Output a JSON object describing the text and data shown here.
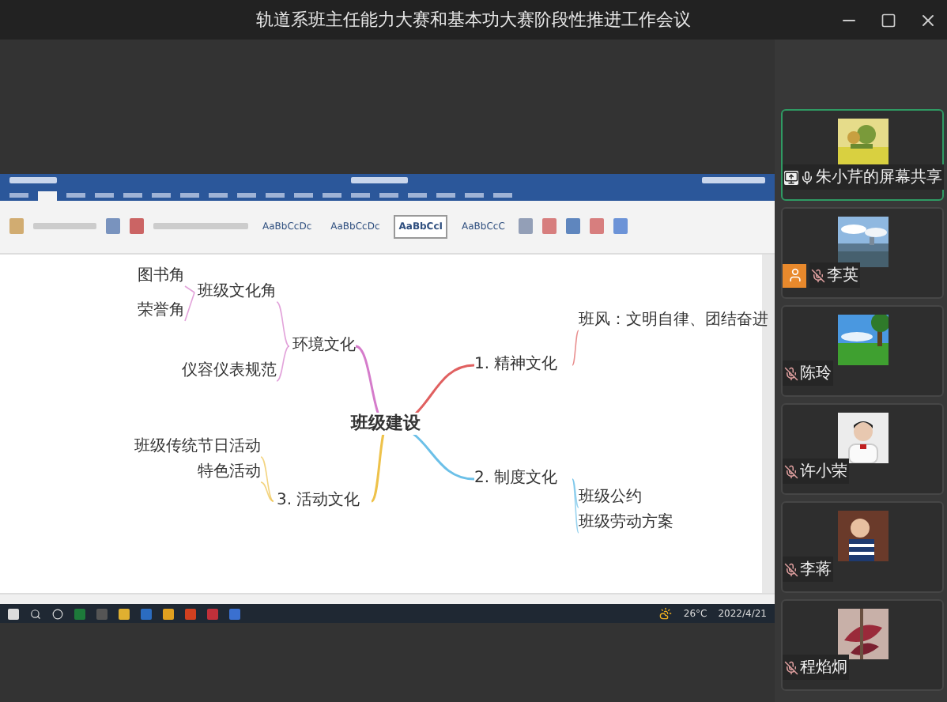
{
  "window": {
    "title": "轨道系班主任能力大赛和基本功大赛阶段性推进工作会议"
  },
  "shared_screen": {
    "style_samples": [
      {
        "label": "AaBbCcDc",
        "selected": false
      },
      {
        "label": "AaBbCcDc",
        "selected": false
      },
      {
        "label": "AaBbCcI",
        "selected": true
      },
      {
        "label": "AaBbCcC",
        "selected": false
      }
    ],
    "mind_map": {
      "center": "班级建设",
      "branches": [
        {
          "label": "环境文化",
          "color": "#d57ccb",
          "children": [
            {
              "label": "班级文化角",
              "children": [
                {
                  "label": "图书角"
                },
                {
                  "label": "荣誉角"
                }
              ]
            },
            {
              "label": "仪容仪表规范"
            }
          ]
        },
        {
          "label": "1. 精神文化",
          "color": "#e06060",
          "children": [
            {
              "label": "班风：文明自律、团结奋进"
            }
          ]
        },
        {
          "label": "2. 制度文化",
          "color": "#6cc0e8",
          "children": [
            {
              "label": "班级公约"
            },
            {
              "label": "班级劳动方案"
            }
          ]
        },
        {
          "label": "3. 活动文化",
          "color": "#eec24a",
          "children": [
            {
              "label": "班级传统节日活动"
            },
            {
              "label": "特色活动"
            }
          ]
        }
      ]
    },
    "taskbar": {
      "weather": "26°C",
      "date": "2022/4/21"
    }
  },
  "participants": [
    {
      "name": "朱小芹的屏幕共享",
      "active": true,
      "sharing": true,
      "host": false,
      "muted": false
    },
    {
      "name": "李英",
      "active": false,
      "sharing": false,
      "host": true,
      "muted": true
    },
    {
      "name": "陈玲",
      "active": false,
      "sharing": false,
      "host": false,
      "muted": true
    },
    {
      "name": "许小荣",
      "active": false,
      "sharing": false,
      "host": false,
      "muted": true
    },
    {
      "name": "李蒋",
      "active": false,
      "sharing": false,
      "host": false,
      "muted": true
    },
    {
      "name": "程焰炯",
      "active": false,
      "sharing": false,
      "host": false,
      "muted": true
    }
  ]
}
